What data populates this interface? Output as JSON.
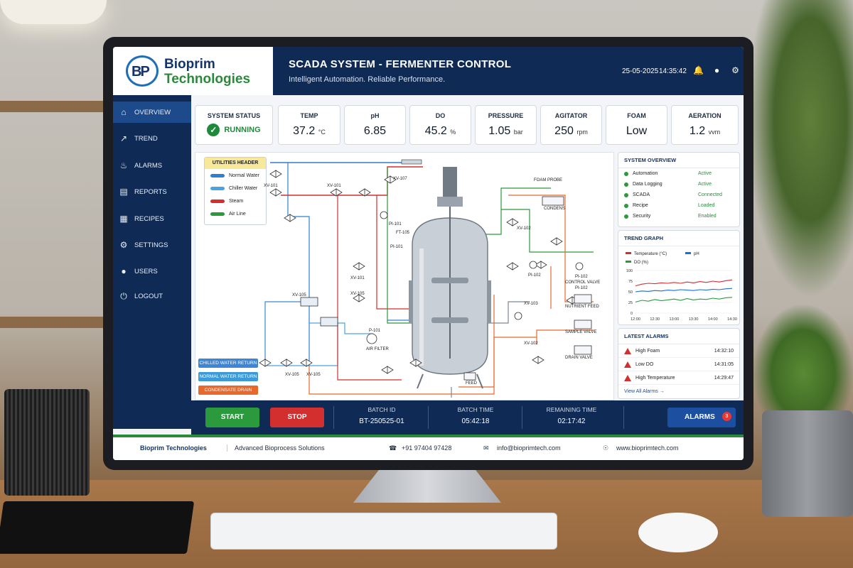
{
  "header": {
    "brand_line1": "Bioprim",
    "brand_line2": "Technologies",
    "logo_text": "BP",
    "title": "SCADA SYSTEM - FERMENTER CONTROL",
    "subtitle": "Intelligent Automation. Reliable Performance.",
    "date": "25-05-2025",
    "time": "14:35:42",
    "icons": [
      "bell-icon",
      "user-icon",
      "gear-icon"
    ]
  },
  "sidebar": {
    "items": [
      {
        "label": "OVERVIEW",
        "icon": "home-icon",
        "active": true
      },
      {
        "label": "TREND",
        "icon": "trend-icon"
      },
      {
        "label": "ALARMS",
        "icon": "bell-icon"
      },
      {
        "label": "REPORTS",
        "icon": "report-icon"
      },
      {
        "label": "RECIPES",
        "icon": "recipe-icon"
      },
      {
        "label": "SETTINGS",
        "icon": "gear-icon"
      },
      {
        "label": "USERS",
        "icon": "user-icon"
      },
      {
        "label": "LOGOUT",
        "icon": "power-icon"
      }
    ]
  },
  "kpis": {
    "status": {
      "label": "SYSTEM STATUS",
      "value": "RUNNING"
    },
    "temp": {
      "label": "TEMP",
      "value": "37.2",
      "unit": "°C"
    },
    "ph": {
      "label": "pH",
      "value": "6.85"
    },
    "do": {
      "label": "DO",
      "value": "45.2",
      "unit": "%"
    },
    "pressure": {
      "label": "PRESSURE",
      "value": "1.05",
      "unit": "bar"
    },
    "agitator": {
      "label": "AGITATOR",
      "value": "250",
      "unit": "rpm"
    },
    "foam": {
      "label": "FOAM",
      "value": "Low"
    },
    "aeration": {
      "label": "AERATION",
      "value": "1.2",
      "unit": "vvm"
    }
  },
  "pid": {
    "legend_title": "UTILITIES HEADER",
    "legend": [
      {
        "label": "Normal Water",
        "color": "#2f7fd0"
      },
      {
        "label": "Chiller Water",
        "color": "#4aa3e0"
      },
      {
        "label": "Steam",
        "color": "#d32f2f"
      },
      {
        "label": "Air Line",
        "color": "#2a9a3c"
      }
    ],
    "returns": [
      {
        "label": "CHILLED WATER RETURN",
        "color": "#3d86d6"
      },
      {
        "label": "NORMAL WATER RETURN",
        "color": "#3d9ad6"
      },
      {
        "label": "CONDENSATE DRAIN",
        "color": "#e8692b"
      }
    ],
    "labels": {
      "xv101a": "XV-101",
      "xv101b": "XV-101",
      "xv107": "XV-107",
      "xv101c": "XV-101",
      "xv105a": "XV-105",
      "xv105b": "XV-105",
      "xv105c": "XV-105",
      "xv105d": "XV-105",
      "xv102a": "XV-102",
      "xv103": "XV-103",
      "xv102b": "XV-102",
      "pi101a": "PI-101",
      "pi101b": "PI-101",
      "pi102a": "PI-102",
      "pi102b": "PI-102",
      "pi102c": "PI-102",
      "p101": "P-101",
      "airfilter": "AIR FILTER",
      "foamprobe": "FOAM PROBE",
      "nutrientfeed": "NUTRIENT FEED",
      "samplevalve": "SAMPLE VALVE",
      "drainvalve": "DRAIN VALVE",
      "controlvalve": "CONTROL VALVE",
      "condens": "CONDENS",
      "feed": "FEED",
      "ft105": "FT-105"
    }
  },
  "overview": {
    "title": "SYSTEM OVERVIEW",
    "rows": [
      {
        "label": "Automation",
        "status": "Active"
      },
      {
        "label": "Data Logging",
        "status": "Active"
      },
      {
        "label": "SCADA",
        "status": "Connected"
      },
      {
        "label": "Recipe",
        "status": "Loaded"
      },
      {
        "label": "Security",
        "status": "Enabled"
      }
    ]
  },
  "chart_data": {
    "type": "line",
    "title": "TREND GRAPH",
    "x": [
      "12:00",
      "12:30",
      "13:00",
      "13:30",
      "14:00",
      "14:30"
    ],
    "ylim": [
      0,
      100
    ],
    "yticks": [
      0,
      25,
      50,
      75,
      100
    ],
    "grid": true,
    "legend_placement": "top",
    "series": [
      {
        "name": "Temperature (°C)",
        "color": "#d32f2f",
        "values": [
          64,
          68,
          70,
          69,
          71,
          70,
          72,
          70,
          73,
          71,
          74,
          72,
          75,
          73,
          76,
          78
        ]
      },
      {
        "name": "pH",
        "color": "#1e6fd0",
        "values": [
          50,
          52,
          51,
          53,
          52,
          54,
          53,
          55,
          54,
          53,
          55,
          54,
          56,
          55,
          57,
          58
        ]
      },
      {
        "name": "DO (%)",
        "color": "#2a9a3c",
        "values": [
          26,
          30,
          28,
          32,
          29,
          31,
          33,
          30,
          34,
          31,
          33,
          32,
          35,
          33,
          36,
          37
        ]
      }
    ]
  },
  "alarms": {
    "title": "LATEST ALARMS",
    "rows": [
      {
        "label": "High Foam",
        "time": "14:32:10"
      },
      {
        "label": "Low DO",
        "time": "14:31:05"
      },
      {
        "label": "High Temperature",
        "time": "14:29:47"
      }
    ],
    "view_all": "View All Alarms →"
  },
  "controls": {
    "start": "START",
    "stop": "STOP",
    "start_color": "#2a9a3c",
    "stop_color": "#d32f2f",
    "batch_id_label": "BATCH ID",
    "batch_id": "BT-250525-01",
    "batch_time_label": "BATCH TIME",
    "batch_time": "05:42:18",
    "remaining_label": "REMAINING TIME",
    "remaining": "02:17:42",
    "alarms_label": "ALARMS",
    "alarm_count": "3"
  },
  "footer": {
    "company": "Bioprim Technologies",
    "tagline": "Advanced Bioprocess Solutions",
    "phone": "+91 97404 97428",
    "email": "info@bioprimtech.com",
    "web": "www.bioprimtech.com"
  }
}
